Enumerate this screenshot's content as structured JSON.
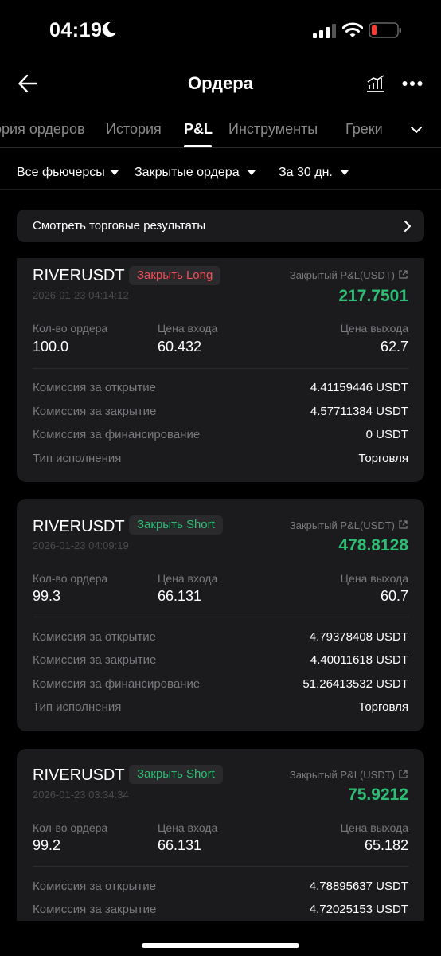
{
  "status_bar": {
    "time": "04:19"
  },
  "header": {
    "title": "Ордера",
    "back_icon": "arrow-left-icon",
    "chart_icon": "chart-icon",
    "more_icon": "more-dots-icon"
  },
  "tabs": [
    {
      "label": "ория ордеров",
      "active": false
    },
    {
      "label": "История",
      "active": false
    },
    {
      "label": "P&L",
      "active": true
    },
    {
      "label": "Инструменты",
      "active": false
    },
    {
      "label": "Греки",
      "active": false
    }
  ],
  "filters": {
    "contracts": "Все фьючерсы",
    "order_status": "Закрытые ордера",
    "period": "За 30 дн."
  },
  "banner": {
    "label": "Смотреть торговые результаты"
  },
  "labels": {
    "pnl": "Закрытый P&L(USDT)",
    "qty": "Кол-во ордера",
    "entry": "Цена входа",
    "exit": "Цена выхода",
    "fee_open": "Комиссия за открытие",
    "fee_close": "Комиссия за закрытие",
    "fee_funding": "Комиссия за финансирование",
    "exec_type": "Тип исполнения"
  },
  "colors": {
    "profit_green": "#2ebd75",
    "loss_red": "#f0505a",
    "card_bg": "#1b1b1d"
  },
  "orders": [
    {
      "symbol": "RIVERUSDT",
      "side": "Закрыть Long",
      "time": "2026-01-23 04:14:12",
      "pnl": "217.7501",
      "qty": "100.0",
      "entry": "60.432",
      "exit": "62.7",
      "fee_open": "4.41159446 USDT",
      "fee_close": "4.57711384 USDT",
      "fee_funding": "0 USDT",
      "exec_type": "Торговля"
    },
    {
      "symbol": "RIVERUSDT",
      "side": "Закрыть Short",
      "time": "2026-01-23 04:09:19",
      "pnl": "478.8128",
      "qty": "99.3",
      "entry": "66.131",
      "exit": "60.7",
      "fee_open": "4.79378408 USDT",
      "fee_close": "4.40011618 USDT",
      "fee_funding": "51.26413532 USDT",
      "exec_type": "Торговля"
    },
    {
      "symbol": "RIVERUSDT",
      "side": "Закрыть Short",
      "time": "2026-01-23 03:34:34",
      "pnl": "75.9212",
      "qty": "99.2",
      "entry": "66.131",
      "exit": "65.182",
      "fee_open": "4.78895637 USDT",
      "fee_close": "4.72025153 USDT"
    }
  ]
}
